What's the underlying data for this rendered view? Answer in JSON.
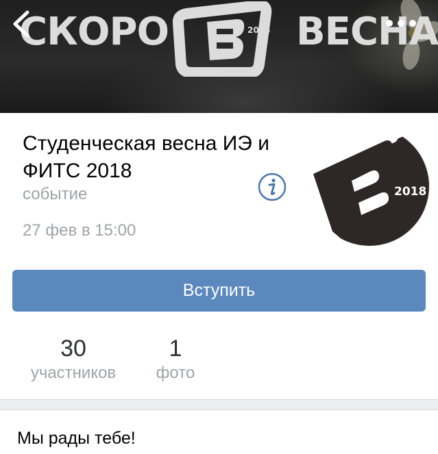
{
  "cover": {
    "left_word": "СКОРО",
    "right_word": "ВЕСНА",
    "logo_year": "2018"
  },
  "header": {
    "back_icon": "chevron-left-icon",
    "more_icon": "more-dots-icon"
  },
  "event": {
    "title": "Студенческая весна ИЭ и ФИТС 2018",
    "type": "событие",
    "datetime": "27 фев в 15:00",
    "info_icon": "info-icon",
    "avatar_year": "2018"
  },
  "actions": {
    "join_label": "Вступить"
  },
  "stats": {
    "members_count": "30",
    "members_label": "участников",
    "photos_count": "1",
    "photos_label": "фото"
  },
  "wall": {
    "welcome_text": "Мы рады тебе!"
  },
  "colors": {
    "accent": "#5b88bd",
    "secondary_text": "#9ea3a8",
    "info_icon": "#4a76a8",
    "separator": "#edeef0"
  }
}
